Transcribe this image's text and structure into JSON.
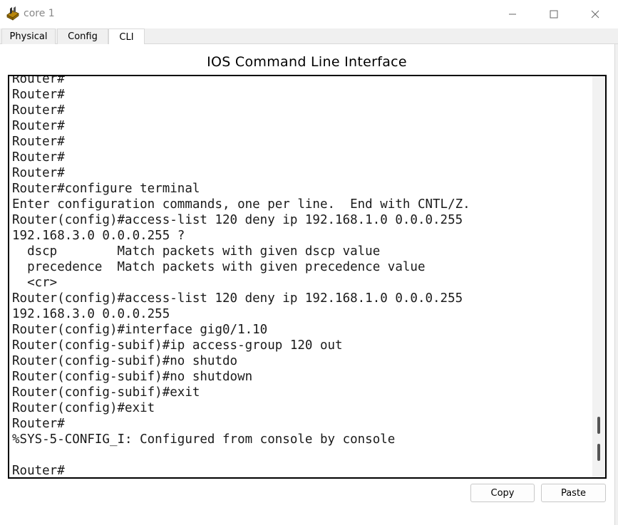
{
  "window": {
    "title": "core 1",
    "icon": "router-app-icon"
  },
  "window_controls": {
    "minimize_icon": "minimize-icon",
    "maximize_icon": "maximize-icon",
    "close_icon": "close-icon"
  },
  "tabs": [
    {
      "label": "Physical",
      "active": false
    },
    {
      "label": "Config",
      "active": false
    },
    {
      "label": "CLI",
      "active": true
    }
  ],
  "panel": {
    "heading": "IOS Command Line Interface"
  },
  "terminal": {
    "lines": [
      "Router#",
      "Router#",
      "Router#",
      "Router#",
      "Router#",
      "Router#",
      "Router#",
      "Router#configure terminal",
      "Enter configuration commands, one per line.  End with CNTL/Z.",
      "Router(config)#access-list 120 deny ip 192.168.1.0 0.0.0.255",
      "192.168.3.0 0.0.0.255 ?",
      "  dscp        Match packets with given dscp value",
      "  precedence  Match packets with given precedence value",
      "  <cr>",
      "Router(config)#access-list 120 deny ip 192.168.1.0 0.0.0.255",
      "192.168.3.0 0.0.0.255",
      "Router(config)#interface gig0/1.10",
      "Router(config-subif)#ip access-group 120 out",
      "Router(config-subif)#no shutdo",
      "Router(config-subif)#no shutdown",
      "Router(config-subif)#exit",
      "Router(config)#exit",
      "Router#",
      "%SYS-5-CONFIG_I: Configured from console by console",
      "",
      "Router#"
    ]
  },
  "buttons": {
    "copy": "Copy",
    "paste": "Paste"
  },
  "colors": {
    "titlebar_bg": "#ffffff",
    "window_bg": "#f0f0f0",
    "terminal_border": "#000000",
    "terminal_text": "#1a1a1a"
  }
}
